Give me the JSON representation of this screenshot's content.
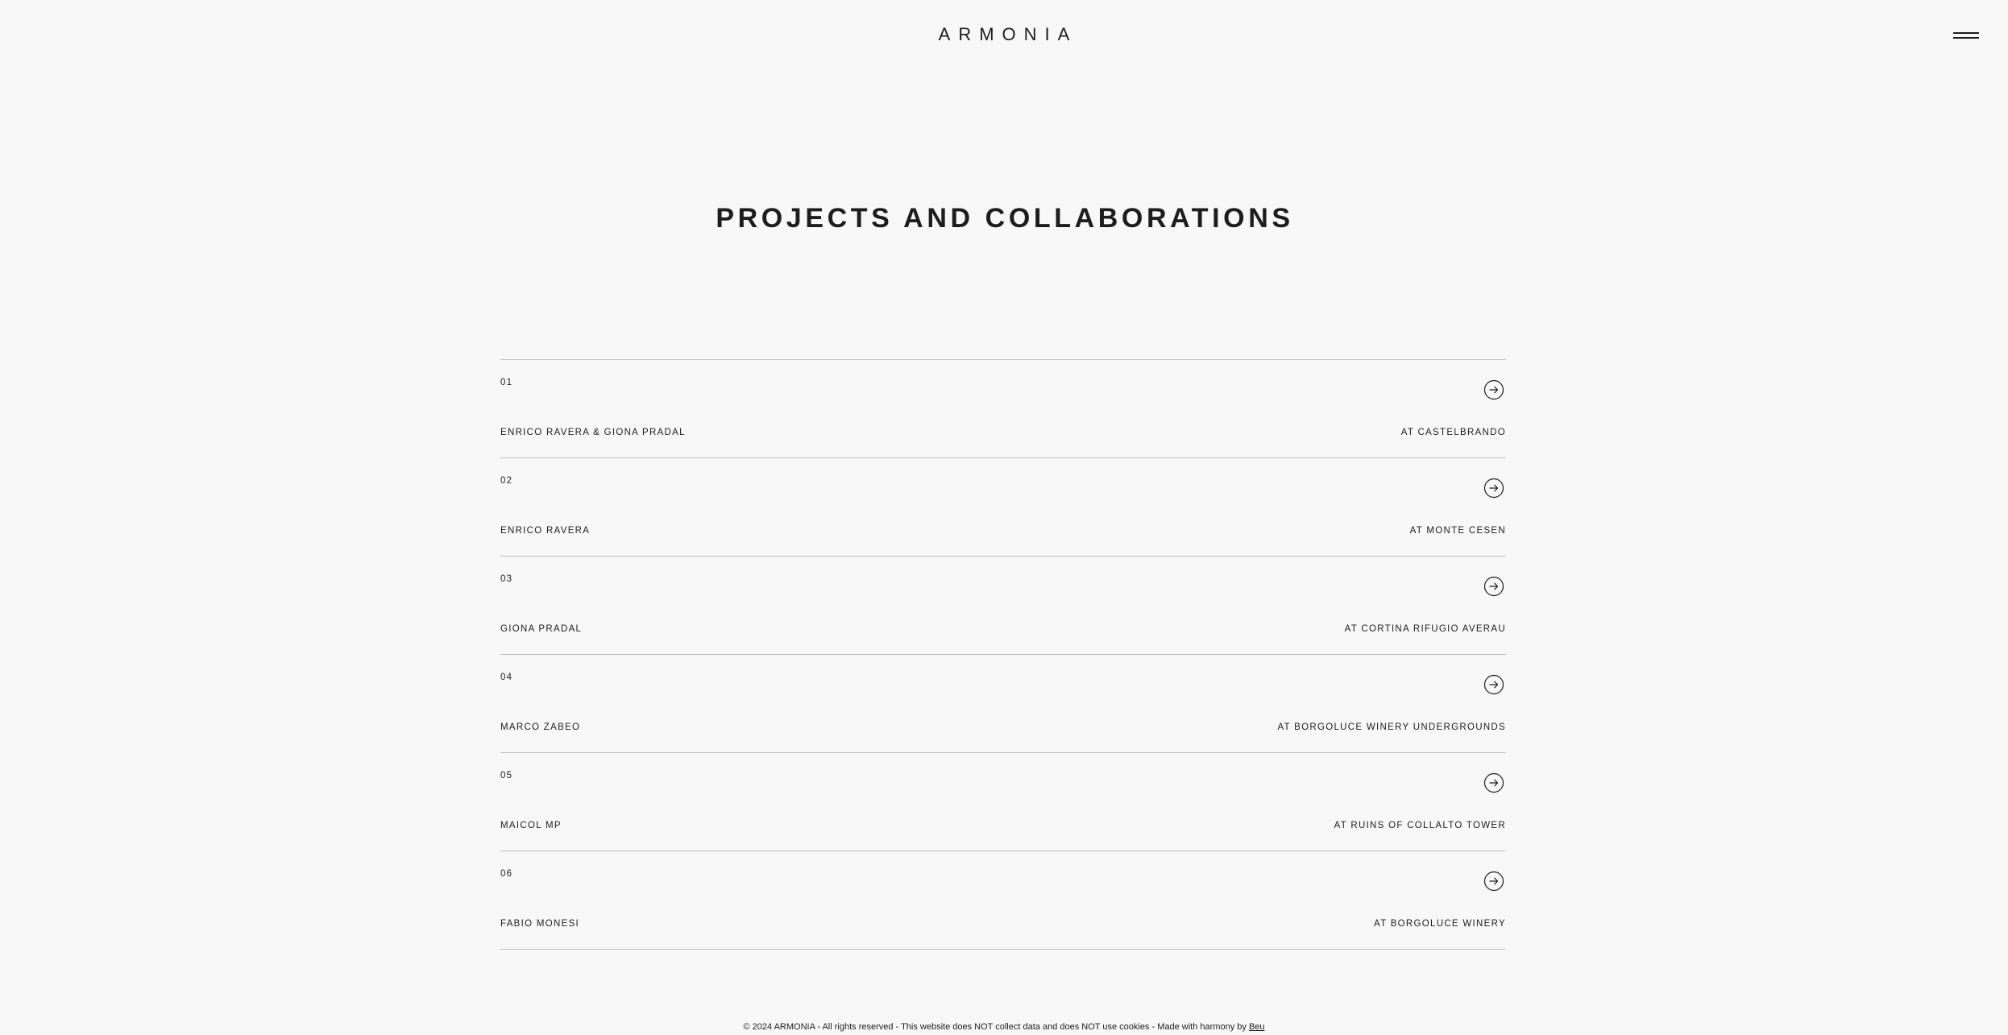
{
  "header": {
    "logo": "ARMONIA",
    "menu_icon": "hamburger-menu-icon"
  },
  "page": {
    "title": "PROJECTS AND COLLABORATIONS"
  },
  "projects": [
    {
      "num": "01",
      "artist": "ENRICO RAVERA & GIONA PRADAL",
      "venue": "AT CASTELBRANDO",
      "icon": "arrow-right-circle-icon"
    },
    {
      "num": "02",
      "artist": "ENRICO RAVERA",
      "venue": "AT MONTE CESEN",
      "icon": "arrow-right-circle-icon"
    },
    {
      "num": "03",
      "artist": "GIONA PRADAL",
      "venue": "AT CORTINA RIFUGIO AVERAU",
      "icon": "arrow-right-circle-icon"
    },
    {
      "num": "04",
      "artist": "MARCO ZABEO",
      "venue": "AT BORGOLUCE WINERY UNDERGROUNDS",
      "icon": "arrow-right-circle-icon"
    },
    {
      "num": "05",
      "artist": "MAICOL MP",
      "venue": "AT RUINS OF COLLALTO TOWER",
      "icon": "arrow-right-circle-icon"
    },
    {
      "num": "06",
      "artist": "FABIO MONESI",
      "venue": "AT BORGOLUCE WINERY",
      "icon": "arrow-right-circle-icon"
    }
  ],
  "footer": {
    "text": "© 2024 ARMONIA - All rights reserved - This website does NOT collect data and does NOT use cookies - Made with harmony by ",
    "link": "Beu"
  },
  "colors": {
    "background": "#f8f8f8",
    "text": "#1d1d1d",
    "divider": "#bdbdbd"
  }
}
